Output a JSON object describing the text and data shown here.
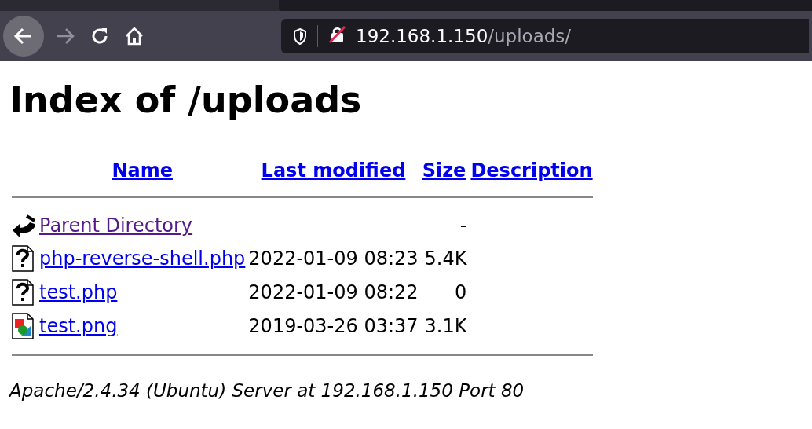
{
  "browser": {
    "back_enabled": true,
    "forward_enabled": false,
    "url_host": "192.168.1.150",
    "url_path": "/uploads/",
    "insecure": true
  },
  "page": {
    "title": "Index of /uploads",
    "columns": [
      "Name",
      "Last modified",
      "Size",
      "Description"
    ],
    "rows": [
      {
        "kind": "back",
        "name": "Parent Directory",
        "visited": true,
        "modified": "",
        "size": "-"
      },
      {
        "kind": "unknown",
        "name": "php-reverse-shell.php",
        "visited": false,
        "modified": "2022-01-09 08:23",
        "size": "5.4K"
      },
      {
        "kind": "unknown",
        "name": "test.php",
        "visited": false,
        "modified": "2022-01-09 08:22",
        "size": "0"
      },
      {
        "kind": "image",
        "name": "test.png",
        "visited": false,
        "modified": "2019-03-26 03:37",
        "size": "3.1K"
      }
    ],
    "address": "Apache/2.4.34 (Ubuntu) Server at 192.168.1.150 Port 80"
  }
}
